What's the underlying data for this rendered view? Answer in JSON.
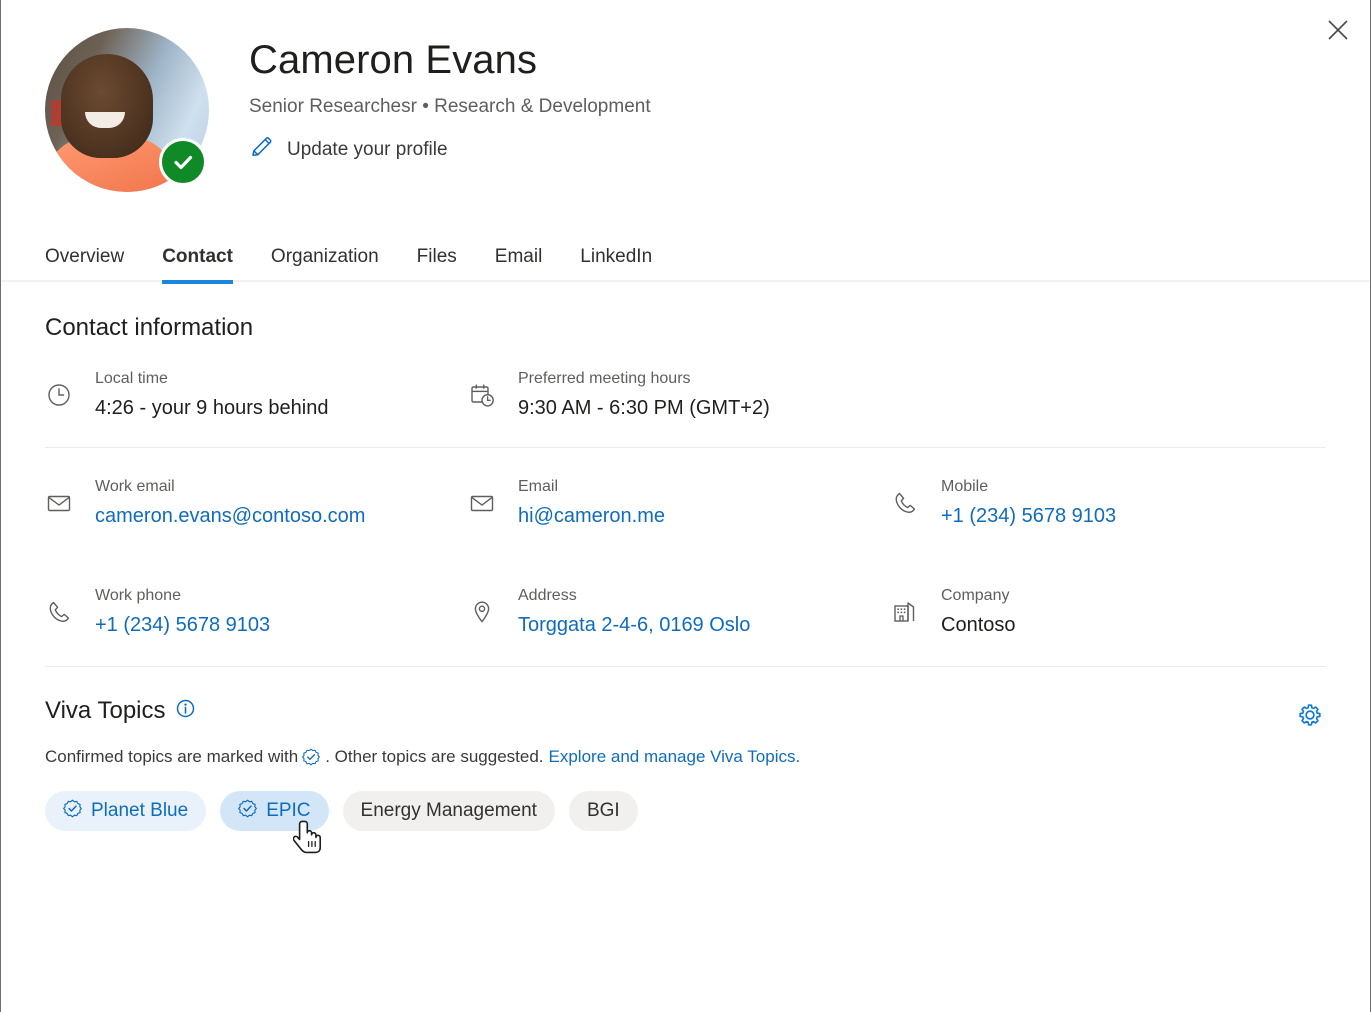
{
  "window": {
    "close_label": "Close",
    "close_icon": "close-icon"
  },
  "profile": {
    "name": "Cameron Evans",
    "role_line": "Senior Researchesr  •  Research & Development",
    "update_link": "Update your profile",
    "update_icon": "pencil-icon",
    "avatar_icon": "avatar-photo",
    "presence": "available",
    "presence_icon": "checkmark-icon"
  },
  "tabs": [
    {
      "label": "Overview",
      "active": false
    },
    {
      "label": "Contact",
      "active": true
    },
    {
      "label": "Organization",
      "active": false
    },
    {
      "label": "Files",
      "active": false
    },
    {
      "label": "Email",
      "active": false
    },
    {
      "label": "LinkedIn",
      "active": false
    }
  ],
  "contact": {
    "heading": "Contact information",
    "time_fields": [
      {
        "icon": "clock-icon",
        "label": "Local time",
        "value": "4:26 - your 9 hours behind",
        "is_link": false
      },
      {
        "icon": "calendar-clock-icon",
        "label": "Preferred meeting hours",
        "value": "9:30 AM - 6:30 PM (GMT+2)",
        "is_link": false
      }
    ],
    "detail_fields": [
      {
        "icon": "mail-icon",
        "label": "Work email",
        "value": "cameron.evans@contoso.com",
        "is_link": true
      },
      {
        "icon": "mail-icon",
        "label": "Email",
        "value": "hi@cameron.me",
        "is_link": true
      },
      {
        "icon": "phone-icon",
        "label": "Mobile",
        "value": "+1 (234) 5678 9103",
        "is_link": true
      },
      {
        "icon": "phone-icon",
        "label": "Work phone",
        "value": "+1 (234) 5678 9103",
        "is_link": true
      },
      {
        "icon": "location-pin-icon",
        "label": "Address",
        "value": "Torggata 2-4-6, 0169 Oslo",
        "is_link": true
      },
      {
        "icon": "building-icon",
        "label": "Company",
        "value": "Contoso",
        "is_link": false
      }
    ]
  },
  "viva_topics": {
    "title": "Viva Topics",
    "info_icon": "info-icon",
    "settings_icon": "gear-icon",
    "description_prefix": "Confirmed topics are marked with",
    "description_suffix": ". Other topics are suggested.",
    "link_text": "Explore and manage Viva Topics.",
    "badge_icon": "verified-badge-icon",
    "chips": [
      {
        "label": "Planet Blue",
        "confirmed": true,
        "hovered": false
      },
      {
        "label": "EPIC",
        "confirmed": true,
        "hovered": true
      },
      {
        "label": "Energy Management",
        "confirmed": false,
        "hovered": false
      },
      {
        "label": "BGI",
        "confirmed": false,
        "hovered": false
      }
    ]
  },
  "colors": {
    "accent": "#0f6cbd",
    "tab_underline": "#1b87dc",
    "presence_green": "#0f8a26",
    "chip_confirmed_bg": "#e9f2fb",
    "chip_hover_bg": "#d3e6f8",
    "chip_suggested_bg": "#f1f0ef",
    "text_primary": "#201f1e",
    "text_secondary": "#605e5c"
  }
}
